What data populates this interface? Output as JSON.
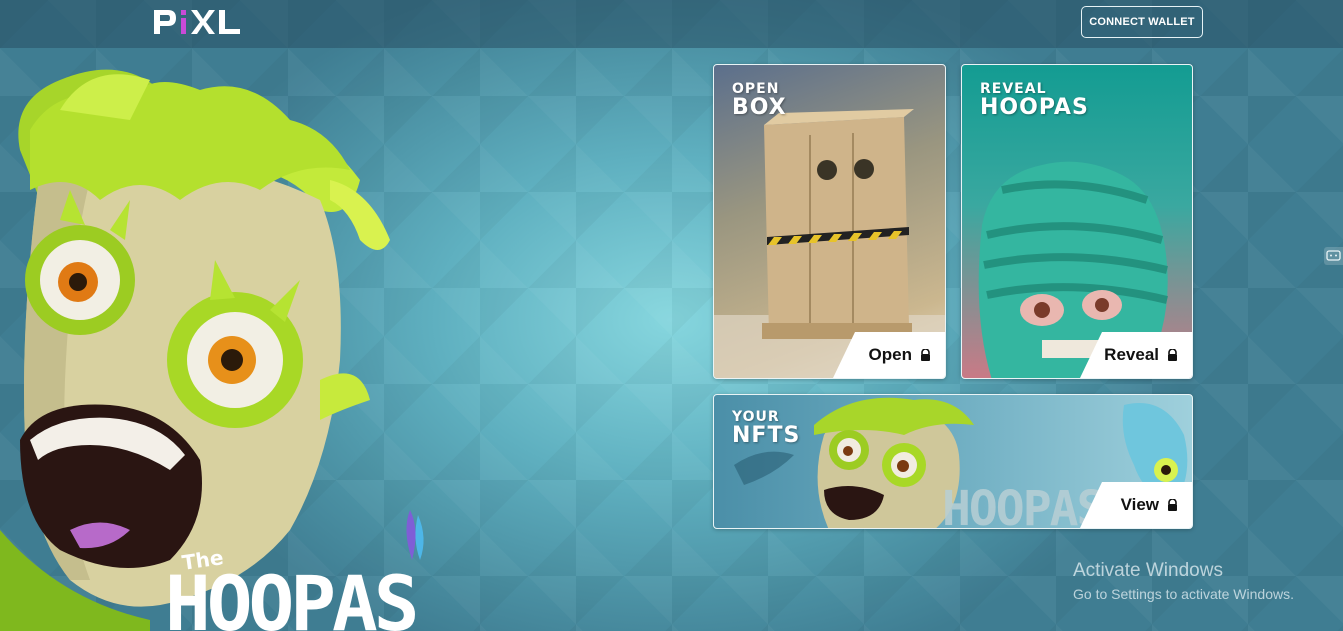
{
  "header": {
    "logo_text": "PiXL",
    "logo_accent_color": "#c94ad8",
    "connect_wallet_label": "CONNECT WALLET"
  },
  "hero": {
    "wordmark_the": "The",
    "wordmark": "HOOPAS"
  },
  "cards": {
    "open_box": {
      "title_line1": "OPEN",
      "title_line2": "BOX",
      "action_label": "Open",
      "action_icon": "lock-icon"
    },
    "reveal_hoopas": {
      "title_line1": "REVEAL",
      "title_line2": "HOOPAS",
      "action_label": "Reveal",
      "action_icon": "lock-icon"
    },
    "your_nfts": {
      "title_line1": "YOUR",
      "title_line2": "NFTS",
      "banner_text": "HOOPAS",
      "action_label": "View",
      "action_icon": "lock-icon"
    }
  },
  "windows_activation": {
    "title": "Activate Windows",
    "subtitle": "Go to Settings to activate Windows."
  },
  "colors": {
    "background": "#5fb0c0",
    "topbar": "#2f5b6e",
    "character_green": "#b6e332",
    "reveal_card_teal": "#1a9e94"
  }
}
